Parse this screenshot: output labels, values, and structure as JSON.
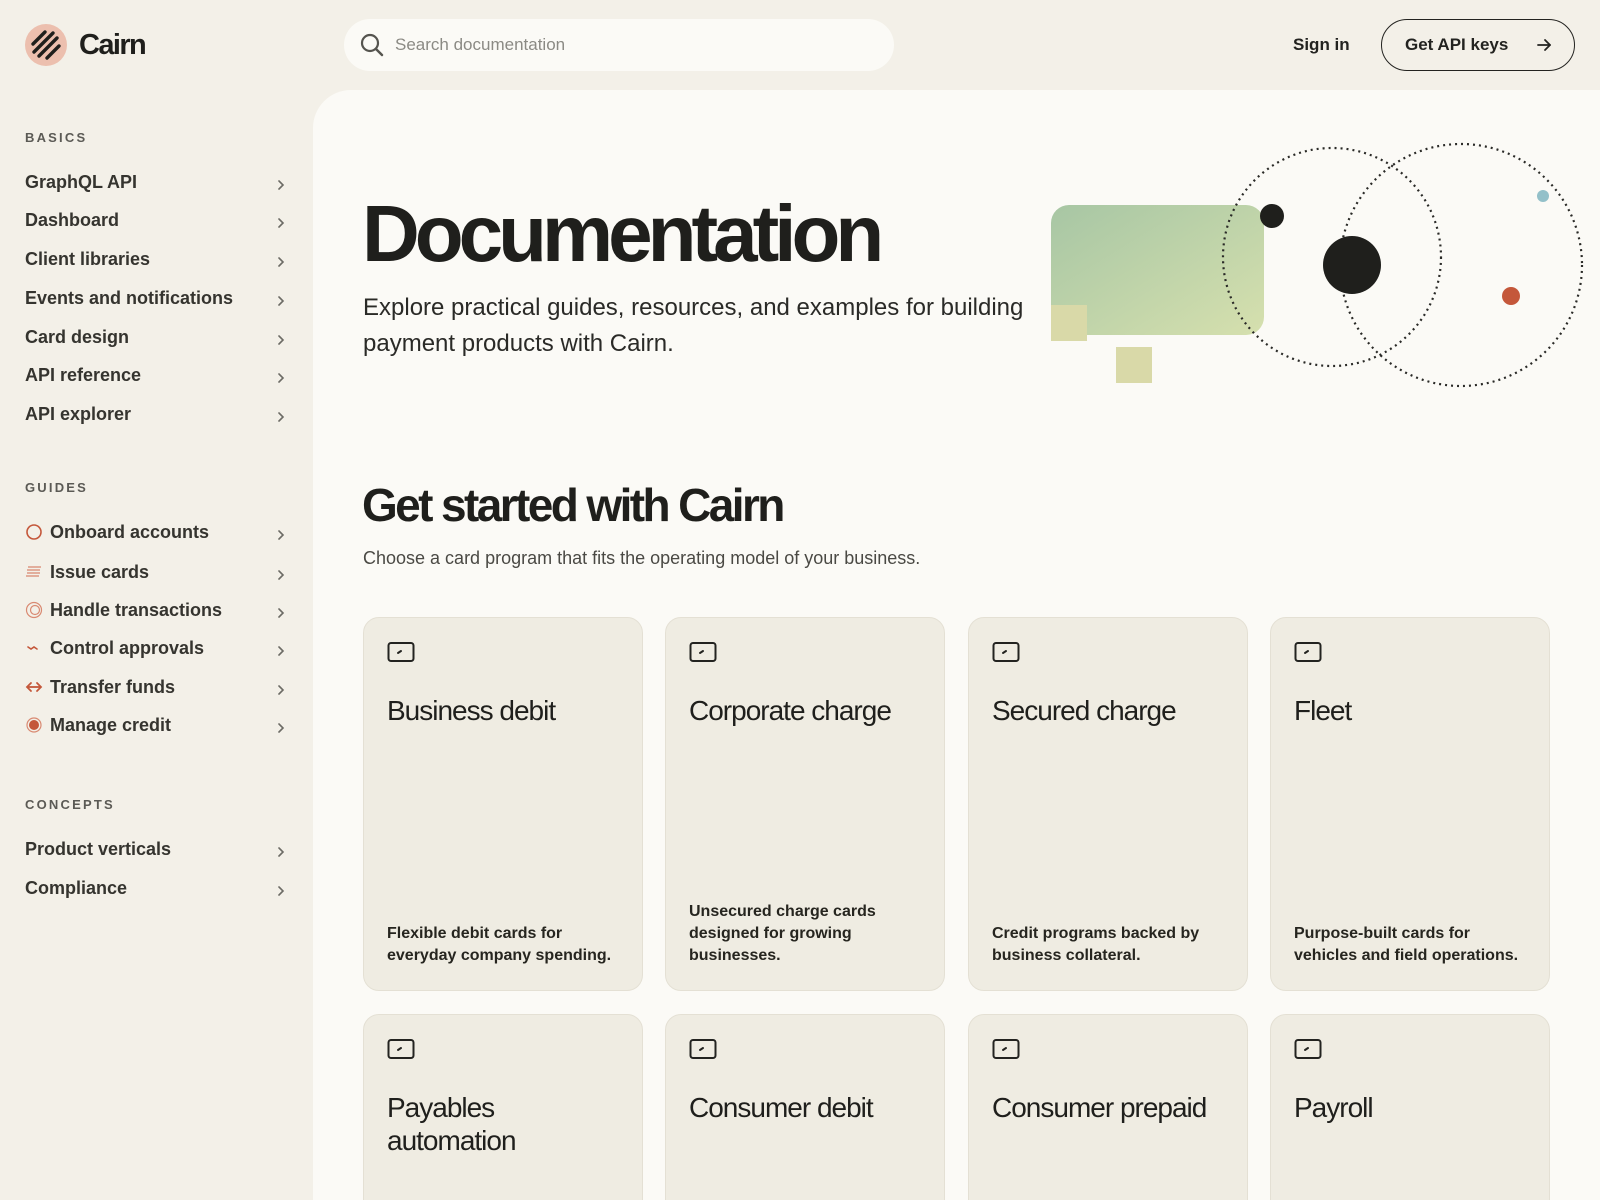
{
  "header": {
    "brand": "Cairn",
    "search_placeholder": "Search documentation",
    "sign_in": "Sign in",
    "api_keys": "Get API keys"
  },
  "sidebar": {
    "basics": {
      "title": "BASICS",
      "items": [
        {
          "label": "GraphQL API"
        },
        {
          "label": "Dashboard"
        },
        {
          "label": "Client libraries"
        },
        {
          "label": "Events and notifications"
        },
        {
          "label": "Card design"
        },
        {
          "label": "API reference"
        },
        {
          "label": "API explorer"
        }
      ]
    },
    "guides": {
      "title": "GUIDES",
      "items": [
        {
          "label": "Onboard accounts",
          "icon": "circle-outline-icon"
        },
        {
          "label": "Issue cards",
          "icon": "striped-card-icon"
        },
        {
          "label": "Handle transactions",
          "icon": "concentric-circles-icon"
        },
        {
          "label": "Control approvals",
          "icon": "zigzag-icon"
        },
        {
          "label": "Transfer funds",
          "icon": "double-arrow-icon"
        },
        {
          "label": "Manage credit",
          "icon": "filled-circle-icon"
        }
      ]
    },
    "concepts": {
      "title": "CONCEPTS",
      "items": [
        {
          "label": "Product verticals"
        },
        {
          "label": "Compliance"
        }
      ]
    }
  },
  "hero": {
    "title": "Documentation",
    "subtitle": "Explore practical guides, resources, and examples for building payment products with Cairn."
  },
  "get_started": {
    "title": "Get started with Cairn",
    "subtitle": "Choose a card program that fits the operating model of your business.",
    "cards": [
      {
        "title": "Business debit",
        "desc": "Flexible debit cards for everyday company spending."
      },
      {
        "title": "Corporate charge",
        "desc": "Unsecured charge cards designed for growing businesses."
      },
      {
        "title": "Secured charge",
        "desc": "Credit programs backed by business collateral."
      },
      {
        "title": "Fleet",
        "desc": "Purpose-built cards for vehicles and field operations."
      },
      {
        "title": "Payables automation",
        "desc": ""
      },
      {
        "title": "Consumer debit",
        "desc": ""
      },
      {
        "title": "Consumer prepaid",
        "desc": ""
      },
      {
        "title": "Payroll",
        "desc": ""
      }
    ]
  },
  "colors": {
    "page_bg": "#f3f0e8",
    "panel_bg": "#fbfaf6",
    "card_bg": "#efece2",
    "accent": "#c4573a",
    "text": "#232320"
  }
}
